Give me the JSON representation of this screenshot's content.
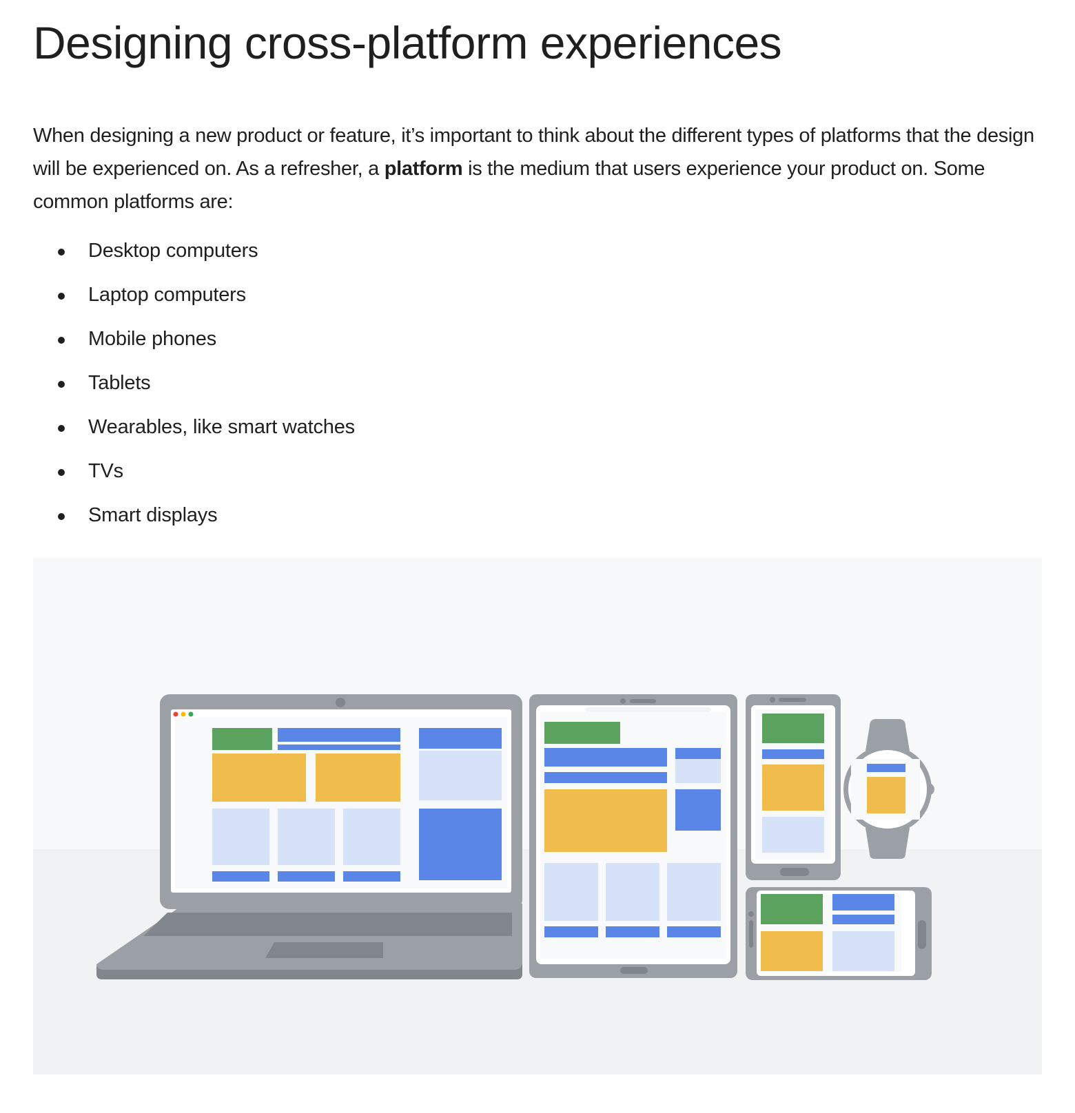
{
  "article": {
    "title": "Designing cross-platform experiences",
    "intro_part1": "When designing a new product or feature, it’s important to think about the different types of platforms that the design will be experienced on. As a refresher, a ",
    "intro_bold": "platform",
    "intro_part2": " is the medium that users experience your product on. Some common platforms are:",
    "platforms": [
      "Desktop computers",
      "Laptop computers",
      "Mobile phones",
      "Tablets",
      "Wearables, like smart watches",
      "TVs",
      "Smart displays"
    ]
  },
  "illustration": {
    "icon": "devices-illustration",
    "colors": {
      "background_top": "#f7f8fa",
      "background_bottom": "#f1f2f4",
      "device_frame": "#9aa0a6",
      "device_dark": "#80868b",
      "screen": "#ffffff",
      "screen_bg": "#f8f9fa",
      "green": "#5aa25d",
      "blue": "#5a86e8",
      "yellow": "#f0bc4b",
      "light_blue": "#d6e2f8",
      "dot_red": "#ea4335",
      "dot_yellow": "#fbbc04",
      "dot_green": "#34a853"
    }
  }
}
